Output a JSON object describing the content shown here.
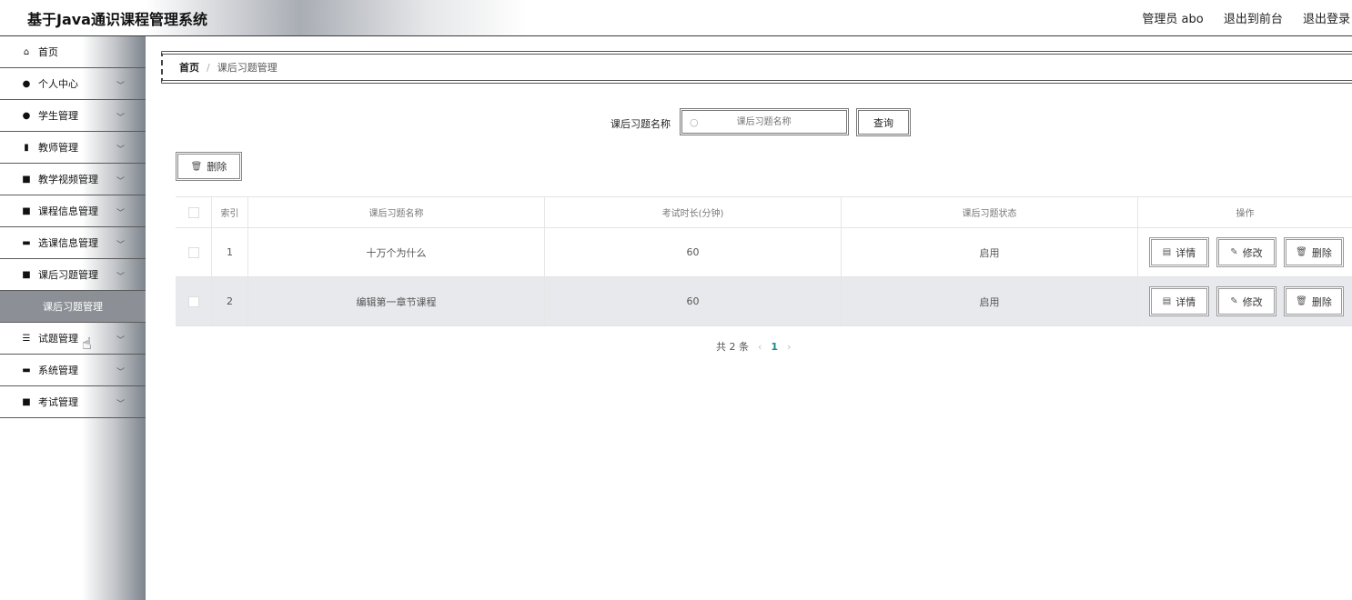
{
  "header": {
    "title": "基于Java通识课程管理系统",
    "user": "管理员 abo",
    "front_link": "退出到前台",
    "logout": "退出登录"
  },
  "sidebar": {
    "items": [
      {
        "label": "首页",
        "icon": "home-icon",
        "glyph": "⌂"
      },
      {
        "label": "个人中心",
        "icon": "user-icon",
        "glyph": "●"
      },
      {
        "label": "学生管理",
        "icon": "pin-icon",
        "glyph": "●"
      },
      {
        "label": "教师管理",
        "icon": "bar-chart-icon",
        "glyph": "▮"
      },
      {
        "label": "教学视频管理",
        "icon": "clipboard-icon",
        "glyph": "■"
      },
      {
        "label": "课程信息管理",
        "icon": "grid-icon",
        "glyph": "■"
      },
      {
        "label": "选课信息管理",
        "icon": "card-icon",
        "glyph": "▬"
      },
      {
        "label": "课后习题管理",
        "icon": "clipboard-check-icon",
        "glyph": "■"
      },
      {
        "label": "试题管理",
        "icon": "sliders-icon",
        "glyph": "☰"
      },
      {
        "label": "系统管理",
        "icon": "briefcase-icon",
        "glyph": "▬"
      },
      {
        "label": "考试管理",
        "icon": "chart-box-icon",
        "glyph": "■"
      }
    ],
    "active_sub": "课后习题管理"
  },
  "breadcrumb": {
    "home": "首页",
    "separator": "/",
    "current": "课后习题管理"
  },
  "search": {
    "label": "课后习题名称",
    "placeholder": "课后习题名称",
    "button": "查询"
  },
  "toolbar": {
    "delete": "删除"
  },
  "table": {
    "headers": [
      "索引",
      "课后习题名称",
      "考试时长(分钟)",
      "课后习题状态",
      "操作"
    ],
    "rows": [
      {
        "index": "1",
        "name": "十万个为什么",
        "duration": "60",
        "status": "启用"
      },
      {
        "index": "2",
        "name": "编辑第一章节课程",
        "duration": "60",
        "status": "启用"
      }
    ],
    "actions": {
      "detail": "详情",
      "edit": "修改",
      "delete": "删除"
    }
  },
  "pagination": {
    "total": "共 2 条",
    "prev": "‹",
    "current": "1",
    "next": "›"
  }
}
